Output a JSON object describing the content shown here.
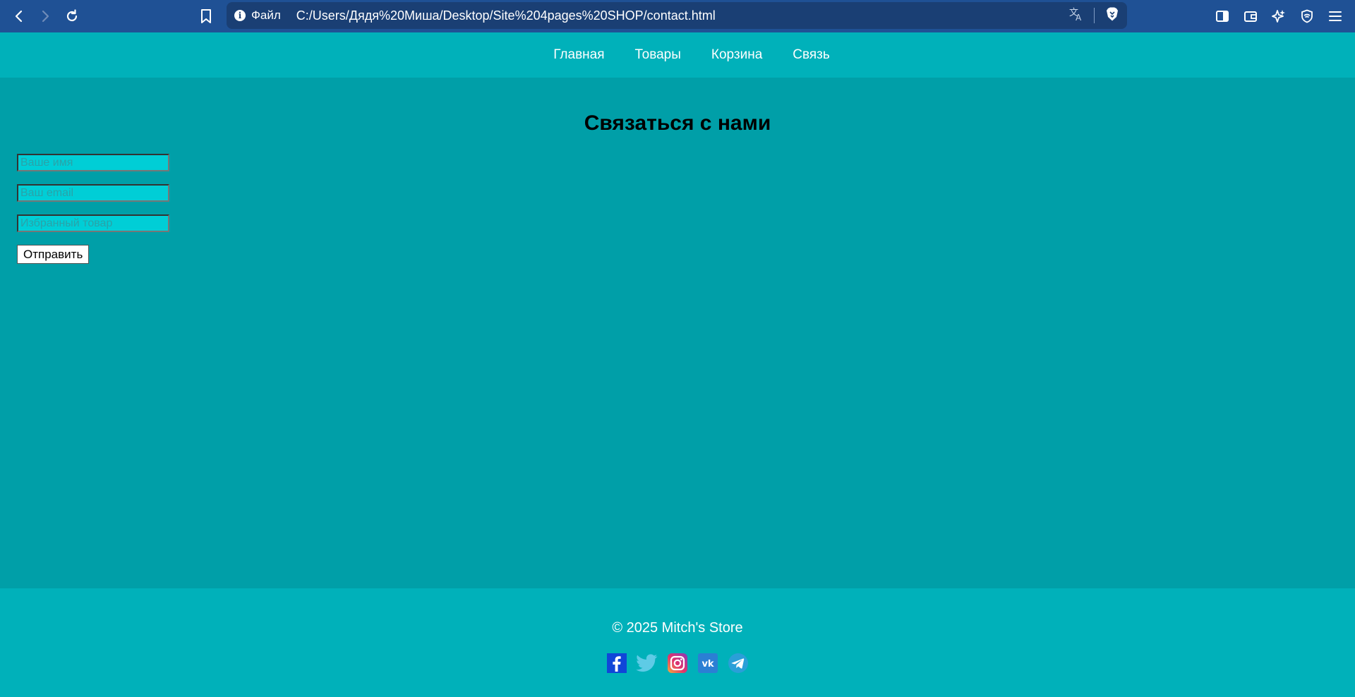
{
  "browser": {
    "file_label": "Файл",
    "url": "C:/Users/Дядя%20Миша/Desktop/Site%204pages%20SHOP/contact.html",
    "icons": [
      "back-icon",
      "forward-icon",
      "reload-icon",
      "bookmark-icon",
      "translate-icon",
      "brave-shield-icon",
      "sidebar-icon",
      "wallet-icon",
      "leo-ai-icon",
      "vpn-icon",
      "menu-icon"
    ]
  },
  "nav": {
    "items": [
      {
        "label": "Главная"
      },
      {
        "label": "Товары"
      },
      {
        "label": "Корзина"
      },
      {
        "label": "Связь"
      }
    ]
  },
  "main": {
    "title": "Связаться с нами",
    "form": {
      "name_placeholder": "Ваше имя",
      "email_placeholder": "Ваш email",
      "product_placeholder": "Избранный товар",
      "submit_label": "Отправить"
    }
  },
  "footer": {
    "copyright": "© 2025 Mitch's Store",
    "socials": [
      "facebook-icon",
      "twitter-icon",
      "instagram-icon",
      "vk-icon",
      "telegram-icon"
    ]
  },
  "colors": {
    "browser_bar": "#1f5195",
    "header": "#00b1ba",
    "main_bg": "#009fa8",
    "input_bg": "#00ced6"
  }
}
